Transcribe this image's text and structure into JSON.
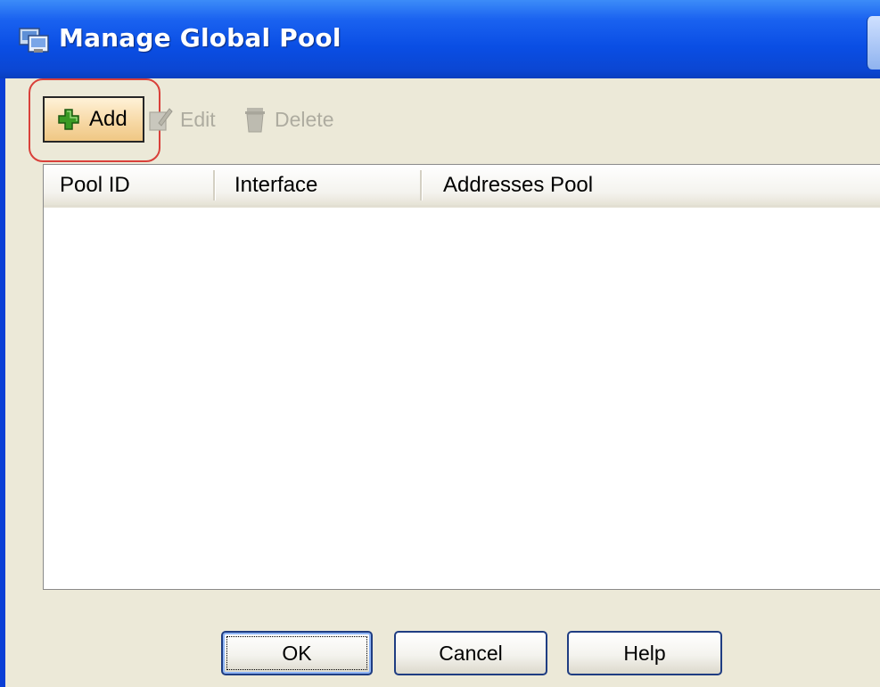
{
  "window": {
    "title": "Manage Global Pool"
  },
  "toolbar": {
    "add_label": "Add",
    "edit_label": "Edit",
    "delete_label": "Delete"
  },
  "table": {
    "columns": [
      "Pool ID",
      "Interface",
      "Addresses Pool"
    ],
    "rows": []
  },
  "buttons": {
    "ok_label": "OK",
    "cancel_label": "Cancel",
    "help_label": "Help"
  },
  "icons": {
    "window": "manage-pool-icon",
    "add": "green-plus-icon",
    "edit": "edit-icon",
    "delete": "trash-icon"
  },
  "colors": {
    "titlebar": "#0a4ee4",
    "dialog_background": "#ece9d8",
    "highlight": "#d9403a",
    "add_icon": "#2f8a1f"
  }
}
